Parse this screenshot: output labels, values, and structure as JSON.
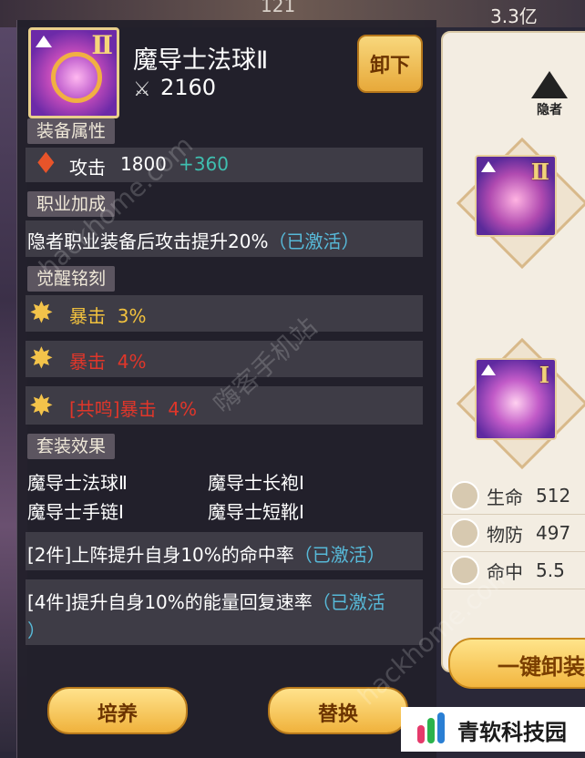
{
  "hud": {
    "top_number": "121",
    "currency": "3.3亿"
  },
  "item": {
    "name": "魔导士法球Ⅱ",
    "tier": "Ⅱ",
    "power": "2160",
    "unequip_label": "卸下"
  },
  "sections": {
    "attributes": "装备属性",
    "class_bonus": "职业加成",
    "awaken": "觉醒铭刻",
    "set": "套装效果"
  },
  "attribute": {
    "name": "攻击",
    "base": "1800",
    "bonus": "+360"
  },
  "class_bonus_text": "隐者职业装备后攻击提升20%",
  "active_label": "（已激活）",
  "awaken_rows": [
    {
      "label": "暴击",
      "value": "3%",
      "color": "#f2c23e"
    },
    {
      "label": "暴击",
      "value": "4%",
      "color": "#e0362a"
    },
    {
      "prefix": "[共鸣]",
      "label": "暴击",
      "value": "4%",
      "color": "#e0362a"
    }
  ],
  "set_items": [
    "魔导士法球Ⅱ",
    "魔导士长袍Ⅰ",
    "魔导士手链Ⅰ",
    "魔导士短靴Ⅰ"
  ],
  "set_effects": [
    {
      "text": "[2件]上阵提升自身10%的命中率",
      "status": "（已激活）"
    },
    {
      "text": "[4件]提升自身10%的能量回复速率",
      "status": "（已激活",
      "status_tail": "）"
    }
  ],
  "buttons": {
    "train": "培养",
    "replace": "替换"
  },
  "right_panel": {
    "class_label": "隐者",
    "slot_a_tier": "Ⅱ",
    "slot_b_tier": "Ⅰ",
    "stats": [
      {
        "label": "生命",
        "value": "512"
      },
      {
        "label": "物防",
        "value": "497"
      },
      {
        "label": "命中",
        "value": "5.5"
      }
    ],
    "onekey_label": "一键卸装"
  },
  "watermarks": {
    "site": "hackhome.com",
    "site_cn": "嗨客手机站"
  },
  "brand": {
    "name": "青软科技园"
  }
}
